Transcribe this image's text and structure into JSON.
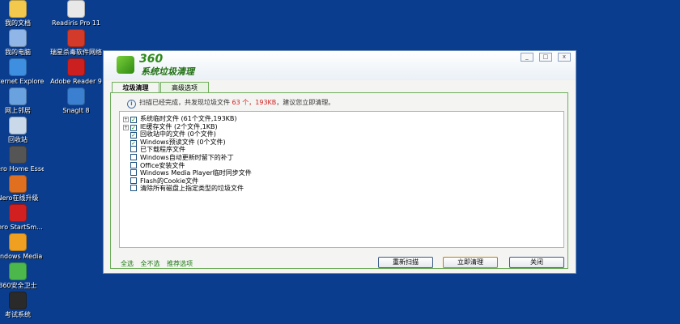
{
  "desktop": {
    "icons": [
      {
        "label": "我的文档",
        "icon": "folder-icon",
        "color": "#f2c94c"
      },
      {
        "label": "Readiris Pro 11",
        "icon": "readiris-icon",
        "color": "#e8e8e8"
      },
      {
        "label": "我的电脑",
        "icon": "computer-icon",
        "color": "#8fb6e6"
      },
      {
        "label": "瑞星杀毒软件网络版",
        "icon": "rising-antivirus-icon",
        "color": "#d43a2a"
      },
      {
        "label": "Internet Explorer",
        "icon": "ie-icon",
        "color": "#3e8fe0"
      },
      {
        "label": "Adobe Reader 9",
        "icon": "adobe-reader-icon",
        "color": "#cc1f1f"
      },
      {
        "label": "网上邻居",
        "icon": "network-icon",
        "color": "#6aa2e0"
      },
      {
        "label": "SnagIt 8",
        "icon": "snagit-icon",
        "color": "#3a7fd0"
      },
      {
        "label": "回收站",
        "icon": "recycle-bin-icon",
        "color": "#c9d9e9"
      },
      {
        "label": "Nero Home Essenti...",
        "icon": "nero-home-icon",
        "color": "#555555"
      },
      {
        "label": "Nero在线升级",
        "icon": "nero-update-icon",
        "color": "#e07020"
      },
      {
        "label": "Nero StartSm...",
        "icon": "nero-startsmart-icon",
        "color": "#d22020"
      },
      {
        "label": "Windows Media Player",
        "icon": "media-player-icon",
        "color": "#f0a020"
      },
      {
        "label": "360安全卫士",
        "icon": "360-safe-icon",
        "color": "#4cb84c"
      },
      {
        "label": "考试系统",
        "icon": "exam-system-icon",
        "color": "#2a2a2a"
      }
    ]
  },
  "window": {
    "logo_number": "360",
    "logo_name": "系统垃圾清理",
    "controls": [
      "_",
      "□",
      "x"
    ],
    "tabs": [
      {
        "label": "垃圾清理"
      },
      {
        "label": "高级选项"
      }
    ],
    "info_prefix": "扫描已经完成，共发现垃圾文件",
    "info_highlight": "63 个，193KB",
    "info_suffix": "，建议您立即清理。",
    "items": [
      {
        "label": "系统临时文件 (61个文件,193KB)",
        "checked": true,
        "expandable": true
      },
      {
        "label": "IE缓存文件 (2个文件,1KB)",
        "checked": true,
        "expandable": true
      },
      {
        "label": "回收站中的文件 (0个文件)",
        "checked": true,
        "expandable": false
      },
      {
        "label": "Windows预读文件 (0个文件)",
        "checked": true,
        "expandable": false
      },
      {
        "label": "已下载程序文件",
        "checked": false,
        "expandable": false
      },
      {
        "label": "Windows自动更新时留下的补丁",
        "checked": false,
        "expandable": false
      },
      {
        "label": "Office安装文件",
        "checked": false,
        "expandable": false
      },
      {
        "label": "Windows Media Player临时同步文件",
        "checked": false,
        "expandable": false
      },
      {
        "label": "Flash的Cookie文件",
        "checked": false,
        "expandable": false
      },
      {
        "label": "清除所有磁盘上指定类型的垃圾文件",
        "checked": false,
        "expandable": false
      }
    ],
    "footer_links": {
      "select_all": "全选",
      "select_none": "全不选",
      "recommended": "推荐选项"
    },
    "buttons": {
      "rescan": "重新扫描",
      "clean_now": "立即清理",
      "close": "关闭"
    }
  }
}
